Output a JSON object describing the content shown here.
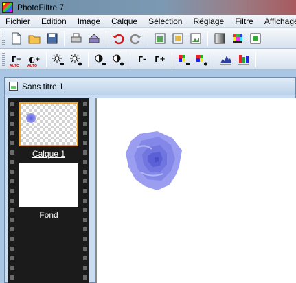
{
  "window": {
    "title": "PhotoFiltre 7"
  },
  "menu": [
    "Fichier",
    "Edition",
    "Image",
    "Calque",
    "Sélection",
    "Réglage",
    "Filtre",
    "Affichage"
  ],
  "toolbar1": {
    "icons": [
      "new-file-icon",
      "open-folder-icon",
      "save-icon",
      "print-icon",
      "scan-icon",
      "undo-icon",
      "redo-icon",
      "image-size-icon",
      "canvas-size-icon",
      "fit-image-icon",
      "gradient-icon",
      "color-palette-icon",
      "hand-icon"
    ]
  },
  "toolbar2": {
    "gamma_auto_label": "Γ",
    "contrast_auto_label": "◐",
    "auto_caption": "AUTO",
    "icons": [
      "gamma-auto-icon",
      "contrast-auto-icon",
      "brightness-minus-icon",
      "brightness-plus-icon",
      "contrast-minus-icon",
      "contrast-plus-icon",
      "gamma-minus-icon",
      "gamma-plus-icon",
      "saturation-minus-icon",
      "saturation-plus-icon",
      "histogram-icon",
      "color-balance-icon"
    ],
    "gamma_label": "Γ"
  },
  "document": {
    "title": "Sans titre 1"
  },
  "layers": [
    {
      "name": "Calque 1",
      "active": true
    },
    {
      "name": "Fond",
      "active": false
    }
  ],
  "colors": {
    "rose": "#8f93ee",
    "selection_border": "#f5a623",
    "filmstrip": "#1b1b1b"
  }
}
